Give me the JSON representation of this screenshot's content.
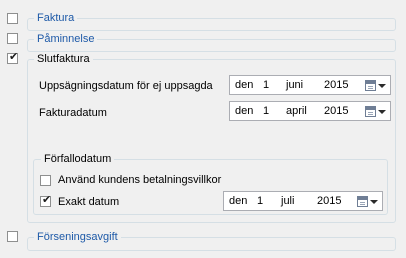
{
  "faktura": {
    "label": "Faktura",
    "checked": false
  },
  "paminnelse": {
    "label": "Påminnelse",
    "checked": false
  },
  "slutfaktura": {
    "label": "Slutfaktura",
    "checked": true,
    "uppsagning": {
      "label": "Uppsägningsdatum för ej uppsagda",
      "prefix": "den",
      "day": "1",
      "month": "juni",
      "year": "2015"
    },
    "fakturadatum": {
      "label": "Fakturadatum",
      "prefix": "den",
      "day": "1",
      "month": "april",
      "year": "2015"
    },
    "forfallodatum": {
      "label": "Förfallodatum",
      "betalningsvillkor": {
        "label": "Använd kundens betalningsvillkor",
        "checked": false
      },
      "exakt": {
        "label": "Exakt datum",
        "checked": true,
        "prefix": "den",
        "day": "1",
        "month": "juli",
        "year": "2015"
      }
    }
  },
  "forseningsavgift": {
    "label": "Förseningsavgift",
    "checked": false
  },
  "icons": {
    "checked_mark": "✔",
    "calendar": "calendar-icon",
    "dropdown": "chevron-down-icon"
  }
}
